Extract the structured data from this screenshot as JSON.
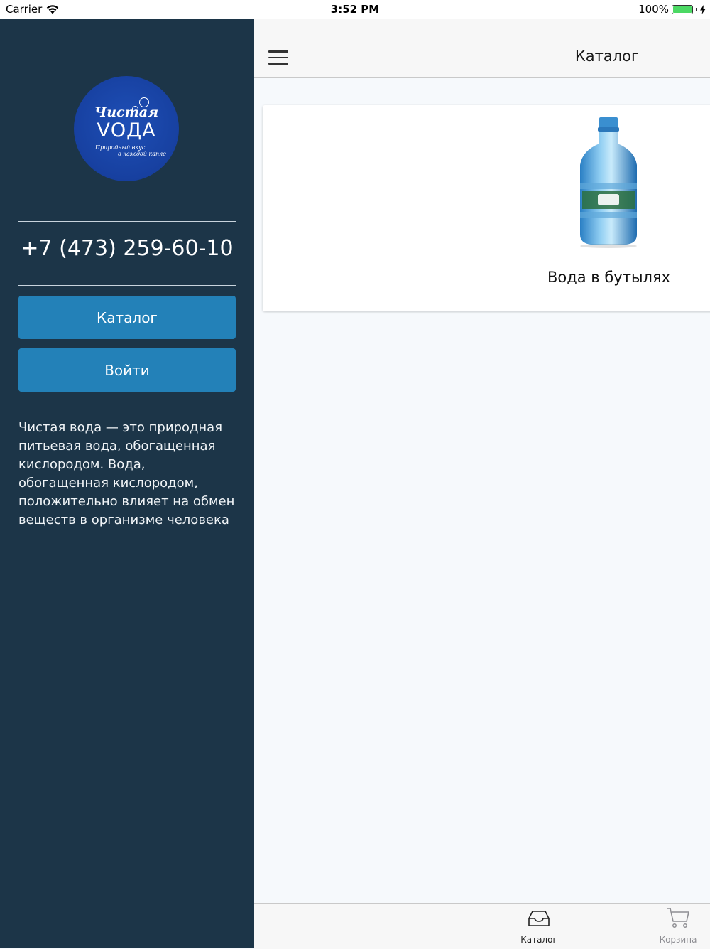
{
  "status_bar": {
    "carrier": "Carrier",
    "time": "3:52 PM",
    "battery_percent": "100%",
    "battery_level": 1.0,
    "wifi_icon": "wifi-icon",
    "charging_icon": "bolt-icon"
  },
  "sidebar": {
    "logo": {
      "line1": "Чистая",
      "line2": "VОДА",
      "tagline1": "Природный вкус",
      "tagline2": "в каждой капле"
    },
    "phone": "+7 (473) 259-60-10",
    "catalog_button": "Каталог",
    "login_button": "Войти",
    "description": "Чистая вода — это природная питьевая вода, обогащенная кислородом. Вода, обогащенная кислородом, положительно влияет на обмен веществ в организме человека"
  },
  "header": {
    "menu_icon": "hamburger-menu-icon",
    "title": "Каталог"
  },
  "catalog": {
    "items": [
      {
        "title": "Вода в бутылях",
        "image": "water-bottle-image"
      }
    ]
  },
  "tab_bar": {
    "tabs": [
      {
        "label": "Каталог",
        "icon": "inbox-tray-icon",
        "active": true
      },
      {
        "label": "Корзина",
        "icon": "shopping-cart-icon",
        "active": false
      }
    ]
  },
  "colors": {
    "sidebar_bg": "#1c3548",
    "button_bg": "#2381b8",
    "logo_bg": "#1740a0",
    "main_bg": "#f6f9fc",
    "active_tab": "#222222",
    "inactive_tab": "#8e8e93"
  }
}
